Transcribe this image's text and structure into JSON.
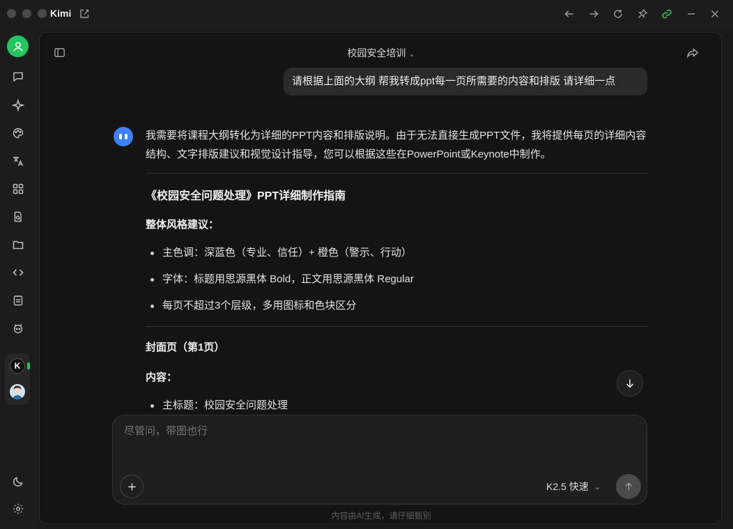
{
  "window": {
    "app_title": "Kimi"
  },
  "icons": {
    "compose": "edit-icon",
    "back": "arrow-left-icon",
    "forward": "arrow-right-icon",
    "reload": "refresh-icon",
    "pin": "pin-icon",
    "link": "link-icon",
    "minimize": "minimize-icon",
    "close": "close-icon"
  },
  "colors": {
    "accent_green": "#22c55e",
    "bot_blue": "#3b82f6",
    "link_green": "#3ec46d"
  },
  "sidebar": {
    "apps": {
      "k_label": "K"
    }
  },
  "chat": {
    "title": "校园安全培训",
    "user_message": "请根据上面的大纲 帮我转成ppt每一页所需要的内容和排版 请详细一点",
    "answer": {
      "intro": "我需要将课程大纲转化为详细的PPT内容和排版说明。由于无法直接生成PPT文件，我将提供每页的详细内容结构、文字排版建议和视觉设计指导，您可以根据这些在PowerPoint或Keynote中制作。",
      "heading": "《校园安全问题处理》PPT详细制作指南",
      "style_label": "整体风格建议：",
      "style_items": [
        "主色调：深蓝色（专业、信任）+ 橙色（警示、行动）",
        "字体：标题用思源黑体 Bold，正文用思源黑体 Regular",
        "每页不超过3个层级，多用图标和色块区分"
      ],
      "cover_label": "封面页（第1页）",
      "content_label": "内容：",
      "cover_items": [
        "主标题：校园安全问题处理"
      ]
    }
  },
  "composer": {
    "placeholder": "尽管问，带图也行",
    "model": "K2.5 快速"
  },
  "footer": {
    "disclaimer": "内容由AI生成，请仔细甄别"
  }
}
